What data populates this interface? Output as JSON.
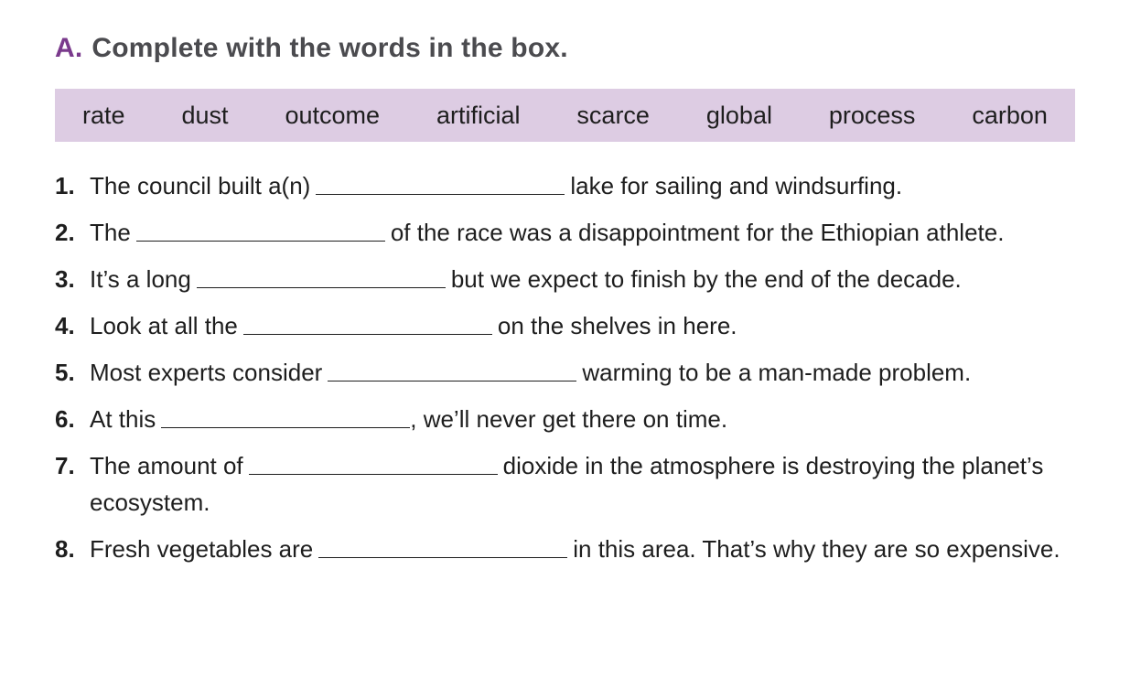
{
  "header": {
    "letter": "A.",
    "instruction": "Complete with the words in the box."
  },
  "word_box": [
    "rate",
    "dust",
    "outcome",
    "artificial",
    "scarce",
    "global",
    "process",
    "carbon"
  ],
  "items": [
    {
      "num": "1.",
      "before": "The council built a(n)",
      "after": "lake for sailing and windsurfing."
    },
    {
      "num": "2.",
      "before": "The",
      "after": "of the race was a disappointment for the Ethiopian athlete."
    },
    {
      "num": "3.",
      "before": "It’s a long",
      "after": "but we expect to finish by the end of the decade."
    },
    {
      "num": "4.",
      "before": "Look at all the",
      "after": "on the shelves in here."
    },
    {
      "num": "5.",
      "before": "Most experts consider",
      "after": "warming to be a man-made problem."
    },
    {
      "num": "6.",
      "before": "At this",
      "after": ", we’ll never get there on time."
    },
    {
      "num": "7.",
      "before": "The amount of",
      "after": "dioxide in the atmosphere is destroying the planet’s ecosystem."
    },
    {
      "num": "8.",
      "before": "Fresh vegetables are",
      "after": "in this area. That’s why they are so expensive."
    }
  ]
}
